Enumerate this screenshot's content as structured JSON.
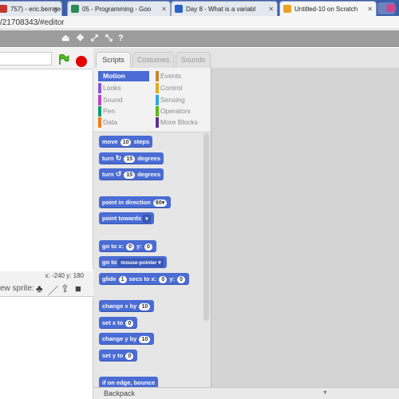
{
  "browser": {
    "tabs": [
      {
        "label": "757) - eric.bernge",
        "favicon_color": "#c0392b"
      },
      {
        "label": "05 - Programming - Goo",
        "favicon_color": "#2e8b57"
      },
      {
        "label": "Day 8 - What is a variabl",
        "favicon_color": "#2563c9"
      },
      {
        "label": "Untitled-10 on Scratch",
        "favicon_color": "#f0a020"
      }
    ],
    "url": "/21708343/#editor"
  },
  "stage": {
    "coords_label": "x: -240  y:  180",
    "new_sprite_label": "ew sprite:"
  },
  "palette": {
    "tabs": [
      "Scripts",
      "Costumes",
      "Sounds"
    ],
    "categories": [
      {
        "label": "Motion",
        "color": "#4a6cd4"
      },
      {
        "label": "Looks",
        "color": "#8a55d7"
      },
      {
        "label": "Sound",
        "color": "#bb42c3"
      },
      {
        "label": "Pen",
        "color": "#0e9a6c"
      },
      {
        "label": "Data",
        "color": "#ee7d16"
      },
      {
        "label": "Events",
        "color": "#c88330"
      },
      {
        "label": "Control",
        "color": "#e1a91a"
      },
      {
        "label": "Sensing",
        "color": "#2ca5e2"
      },
      {
        "label": "Operators",
        "color": "#5cb712"
      },
      {
        "label": "More Blocks",
        "color": "#632d99"
      }
    ],
    "blocks": {
      "move": {
        "pre": "move",
        "val": "10",
        "post": "steps"
      },
      "turn_right": {
        "pre": "turn",
        "val": "15",
        "post": "degrees"
      },
      "turn_left": {
        "pre": "turn",
        "val": "15",
        "post": "degrees"
      },
      "point_dir": {
        "pre": "point in direction",
        "val": "90▾"
      },
      "point_towards": {
        "pre": "point towards",
        "val": "▾"
      },
      "goto_xy": {
        "pre": "go to x:",
        "x": "0",
        "mid": "y:",
        "y": "0"
      },
      "goto": {
        "pre": "go to",
        "val": "mouse-pointer ▾"
      },
      "glide": {
        "pre": "glide",
        "secs": "1",
        "mid1": "secs to x:",
        "x": "0",
        "mid2": "y:",
        "y": "0"
      },
      "change_x": {
        "pre": "change x by",
        "val": "10"
      },
      "set_x": {
        "pre": "set x to",
        "val": "0"
      },
      "change_y": {
        "pre": "change y by",
        "val": "10"
      },
      "set_y": {
        "pre": "set y to",
        "val": "0"
      },
      "edge": {
        "pre": "if on edge, bounce"
      }
    }
  },
  "backpack": {
    "label": "Backpack",
    "arrow": "▼"
  }
}
